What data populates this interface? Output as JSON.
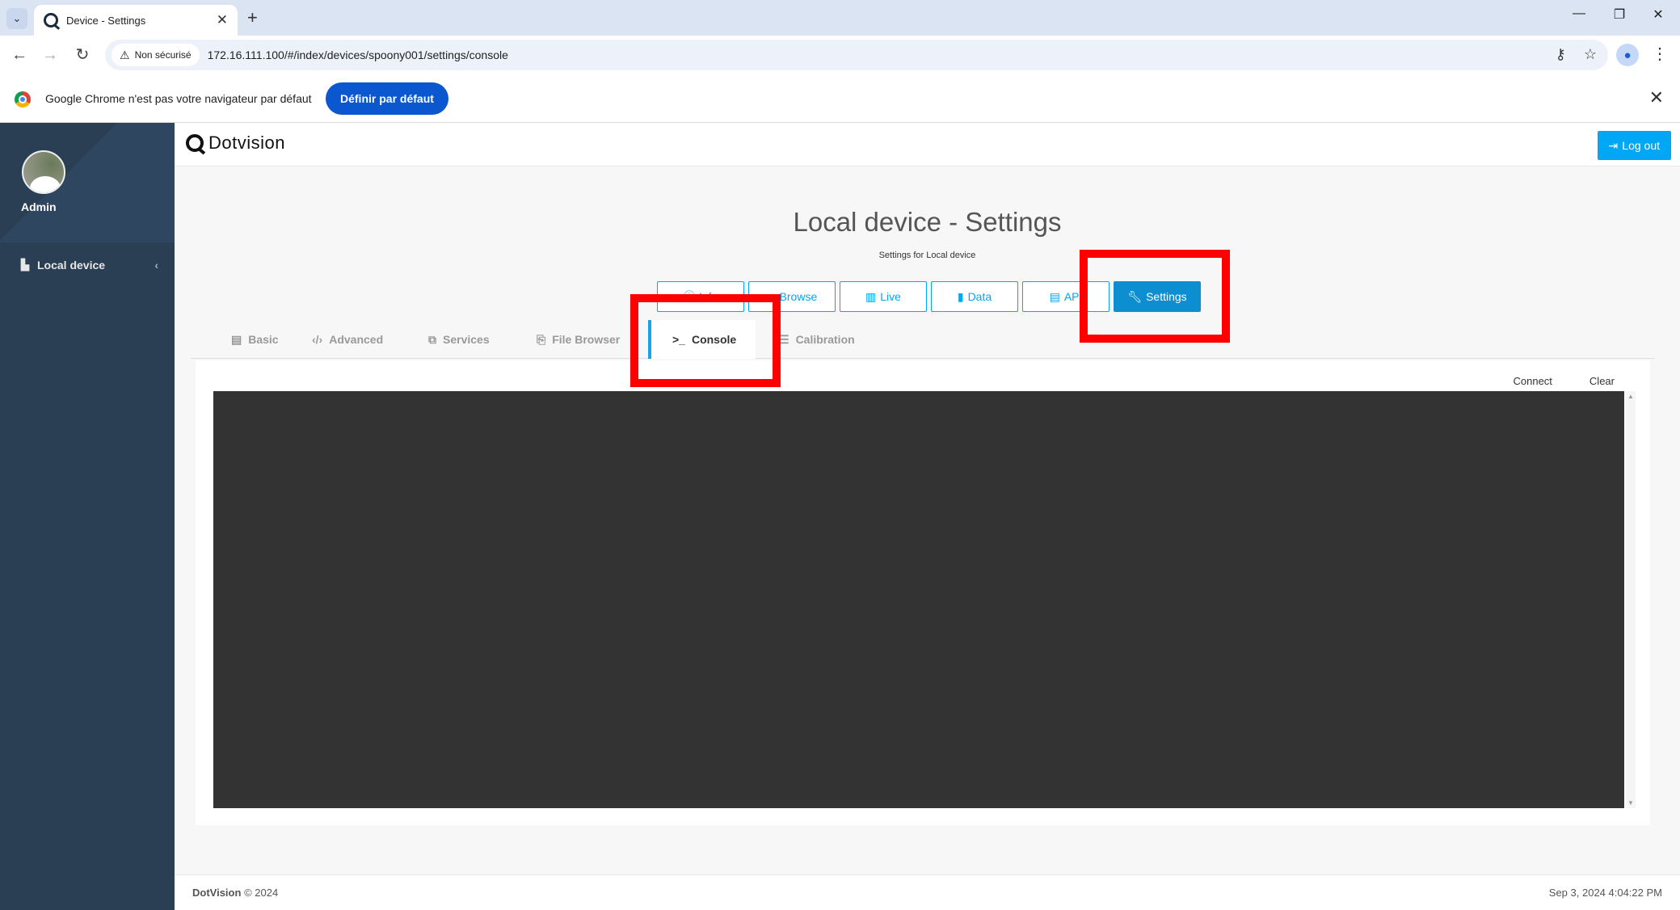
{
  "browser": {
    "tab_title": "Device - Settings",
    "security_label": "Non sécurisé",
    "url": "172.16.111.100/#/index/devices/spoony001/settings/console",
    "infobar_text": "Google Chrome n'est pas votre navigateur par défaut",
    "infobar_button": "Définir par défaut"
  },
  "sidebar": {
    "user_name": "Admin",
    "items": [
      {
        "label": "Local device",
        "icon": "area-chart-icon"
      }
    ]
  },
  "topnav": {
    "brand": "Dotvision",
    "logout_label": "Log out"
  },
  "page": {
    "title": "Local device - Settings",
    "subtitle": "Settings for Local device"
  },
  "nav_buttons": [
    {
      "label": "Info",
      "icon": "info-icon",
      "active": false
    },
    {
      "label": "Browse",
      "icon": "folder-icon",
      "active": false
    },
    {
      "label": "Live",
      "icon": "bar-chart-icon",
      "active": false
    },
    {
      "label": "Data",
      "icon": "file-icon",
      "active": false
    },
    {
      "label": "API",
      "icon": "api-icon",
      "active": false
    },
    {
      "label": "Settings",
      "icon": "wrench-icon",
      "active": true
    }
  ],
  "subtabs": [
    {
      "label": "Basic",
      "icon": "list-icon",
      "active": false
    },
    {
      "label": "Advanced",
      "icon": "code-icon",
      "active": false
    },
    {
      "label": "Services",
      "icon": "copy-icon",
      "active": false
    },
    {
      "label": "File Browser",
      "icon": "file-browser-icon",
      "active": false
    },
    {
      "label": "Console",
      "icon": "terminal-icon",
      "active": true
    },
    {
      "label": "Calibration",
      "icon": "calibration-icon",
      "active": false
    }
  ],
  "console": {
    "connect_label": "Connect",
    "clear_label": "Clear"
  },
  "footer": {
    "brand": "DotVision",
    "copyright": "© 2024",
    "timestamp": "Sep 3, 2024 4:04:22 PM"
  },
  "colors": {
    "sidebar_bg": "#2a3f54",
    "accent": "#00a7f4",
    "active_button": "#0d8ed0",
    "terminal_bg": "#333333",
    "highlight": "#ff0000"
  }
}
